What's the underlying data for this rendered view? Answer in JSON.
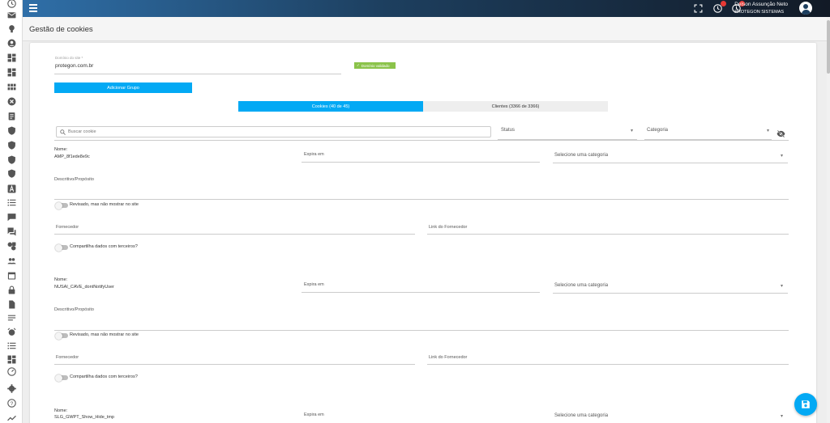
{
  "header": {
    "user_name": "Delson Assunção Neto",
    "company": "PROTEGON SISTEMAS"
  },
  "page": {
    "title": "Gestão de cookies"
  },
  "domain": {
    "label": "Domínio do site *",
    "value": "protegon.com.br",
    "validated_label": "Domínio validado"
  },
  "actions": {
    "add_group": "Adicionar Grupo"
  },
  "tabs": [
    {
      "label": "Cookies (40 de 45)",
      "active": true
    },
    {
      "label": "Clientes (3366 de 3366)",
      "active": false
    }
  ],
  "filters": {
    "search_placeholder": "Buscar cookie",
    "status_label": "Status",
    "category_label": "Categoria"
  },
  "field_labels": {
    "name": "Nome:",
    "expires": "Expira em",
    "category_select": "Selecione uma categoria",
    "description": "Descritivo/Propósito",
    "reviewed_toggle": "Revisado, mas não mostrar no site",
    "supplier": "Fornecedor",
    "supplier_link": "Link do Fornecedor",
    "shares_toggle": "Compartilha dados com terceiros?"
  },
  "cookies": [
    {
      "name": "AMP_8f1ede8e9c"
    },
    {
      "name": "NUSAI_CAVE_dontNotifyUser"
    },
    {
      "name": "SLG_GWPT_Show_Hide_tmp"
    }
  ],
  "colors": {
    "accent": "#03a9f4",
    "validated": "#8bc34a",
    "header_start": "#2f6fa8",
    "header_end": "#121a26"
  },
  "rail_icons": [
    "clock-icon",
    "mail-icon",
    "lightbulb-icon",
    "account-icon",
    "dashboard-icon",
    "dashboard-alt-icon",
    "grid-icon",
    "cancel-icon",
    "clipboard-icon",
    "shield-icon",
    "shield-check-icon",
    "shield-alt-icon",
    "shield-lock-icon",
    "font-icon",
    "list-icon",
    "chat-icon",
    "forum-icon",
    "tools-icon",
    "people-icon",
    "calendar-icon",
    "lock-icon",
    "file-icon",
    "notes-icon",
    "alarm-icon",
    "list-alt-icon",
    "view-dashboard-icon",
    "speedometer-icon",
    "gear-icon",
    "help-icon",
    "trending-icon"
  ]
}
